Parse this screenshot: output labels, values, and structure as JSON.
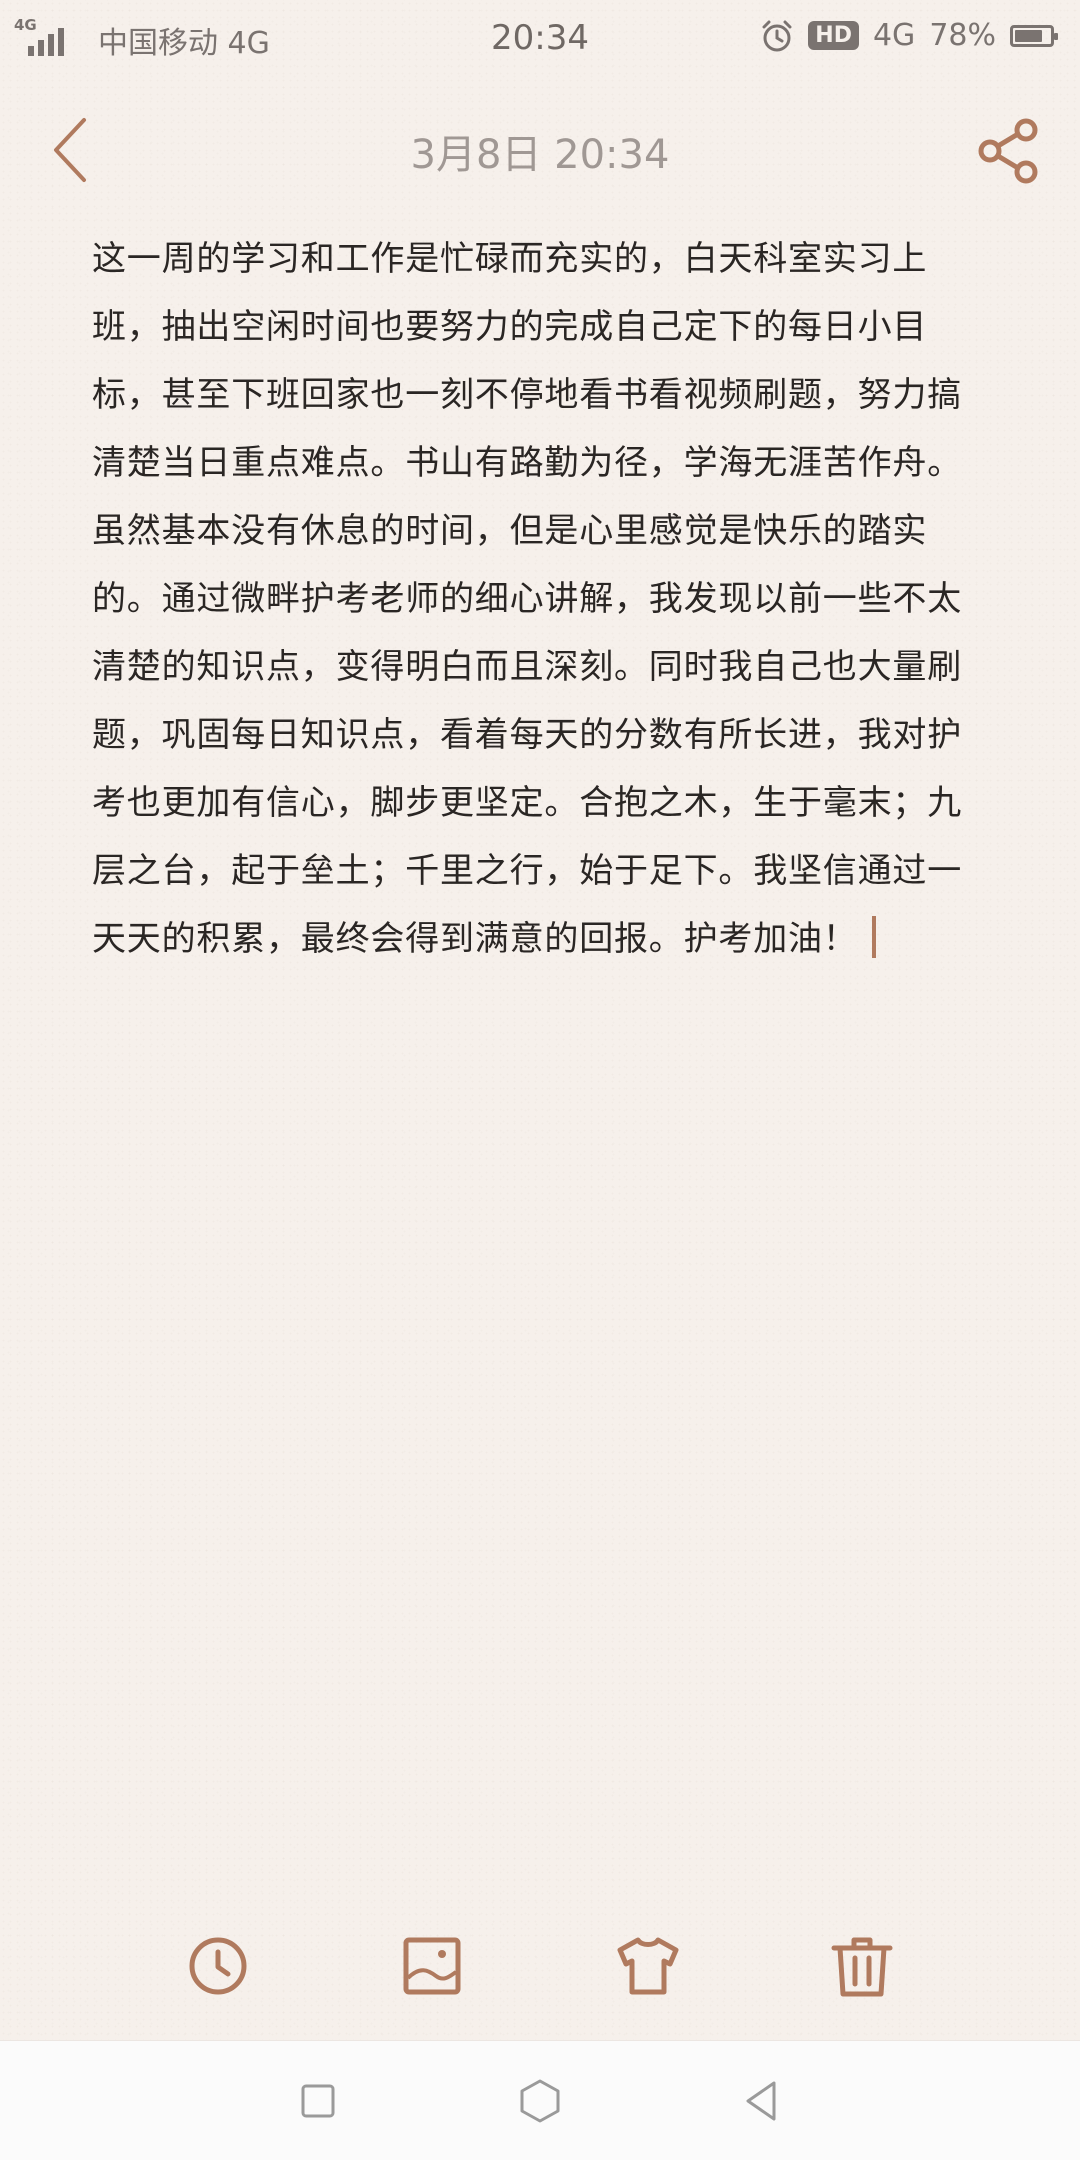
{
  "status_bar": {
    "network_tag": "4G",
    "carrier": "中国移动 4G",
    "time": "20:34",
    "hd_label": "HD",
    "network": "4G",
    "battery_text": "78%",
    "battery_level": 0.78,
    "icons": [
      "signal-icon",
      "alarm-icon",
      "battery-icon"
    ]
  },
  "header": {
    "title": "3月8日 20:34",
    "back_icon": "chevron-left-icon",
    "share_icon": "share-icon"
  },
  "note": {
    "text": "这一周的学习和工作是忙碌而充实的，白天科室实习上班，抽出空闲时间也要努力的完成自己定下的每日小目标，甚至下班回家也一刻不停地看书看视频刷题，努力搞清楚当日重点难点。书山有路勤为径，学海无涯苦作舟。虽然基本没有休息的时间，但是心里感觉是快乐的踏实的。通过微畔护考老师的细心讲解，我发现以前一些不太清楚的知识点，变得明白而且深刻。同时我自己也大量刷题，巩固每日知识点，看着每天的分数有所长进，我对护考也更加有信心，脚步更坚定。合抱之木，生于毫末；九层之台，起于垒土；千里之行，始于足下。我坚信通过一天天的积累，最终会得到满意的回报。护考加油！"
  },
  "toolbar": {
    "items": [
      "clock-icon",
      "image-icon",
      "shirt-icon",
      "trash-icon"
    ]
  },
  "nav_bar": {
    "items": [
      "recents-square-icon",
      "home-hexagon-icon",
      "back-triangle-icon"
    ]
  },
  "colors": {
    "background": "#f6f0eb",
    "accent": "#b07a5e",
    "text": "#2a2624",
    "status_text": "#7a7370",
    "title_text": "#a09894"
  }
}
